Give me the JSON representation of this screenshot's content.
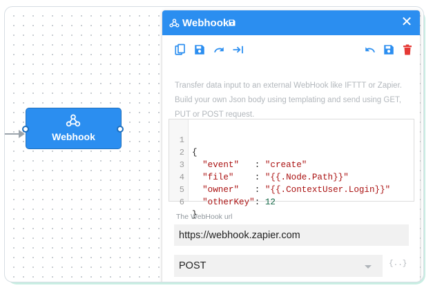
{
  "canvas": {
    "node": {
      "label": "Webhook",
      "icon": "webhook-icon"
    }
  },
  "panel": {
    "header": {
      "title": "Webhook",
      "icon": "webhook-icon",
      "close_label": "✕"
    },
    "toolbar": {
      "left": [
        "copy-icon",
        "save-icon",
        "redo-icon",
        "step-forward-icon"
      ],
      "right": [
        "undo-icon",
        "save-icon",
        "delete-icon"
      ]
    },
    "description": "Transfer data input to an external WebHook like IFTTT or Zapier. Build your own Json body using templating and send using GET, PUT or POST request.",
    "code": {
      "line_numbers": [
        "1",
        "2",
        "3",
        "4",
        "5",
        "6"
      ],
      "open_brace": "{",
      "close_brace": "}",
      "rows": [
        {
          "key": "\"event\"",
          "pad": "   ",
          "sep": ": ",
          "value": "\"create\""
        },
        {
          "key": "\"file\"",
          "pad": "    ",
          "sep": ": ",
          "value": "\"{{.Node.Path}}\""
        },
        {
          "key": "\"owner\"",
          "pad": "   ",
          "sep": ": ",
          "value": "\"{{.ContextUser.Login}}\""
        },
        {
          "key": "\"otherKey\"",
          "pad": "",
          "sep": ": ",
          "value": "12"
        }
      ]
    },
    "url_field": {
      "label": "The WebHook url",
      "value": "https://webhook.zapier.com"
    },
    "method_select": {
      "value": "POST"
    },
    "template_hint": "{..}"
  },
  "colors": {
    "accent": "#2b8ef0",
    "danger": "#e53935",
    "key": "#aa1111",
    "number": "#116644"
  }
}
